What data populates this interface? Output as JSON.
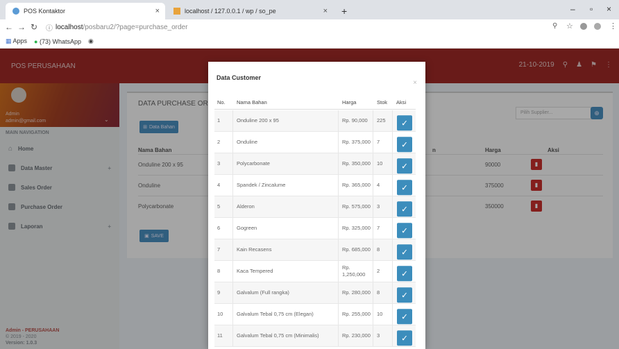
{
  "browser": {
    "tabs": [
      {
        "title": "POS Kontaktor",
        "active": true
      },
      {
        "title": "localhost / 127.0.0.1 / wp / so_pe",
        "active": false
      }
    ],
    "url_host": "localhost",
    "url_path": "/posbaru2/?page=purchase_order",
    "bookmarks": [
      "Apps",
      "(73) WhatsApp"
    ]
  },
  "app": {
    "brand": "POS PERUSAHAAN",
    "date": "21-10-2019",
    "user": {
      "name": "Admin",
      "email": "admin@gmail.com"
    },
    "main_navigation": "MAIN NAVIGATION",
    "menu": [
      {
        "label": "Home",
        "icon": "home-icon",
        "expandable": false
      },
      {
        "label": "Data Master",
        "icon": "folder-icon",
        "expandable": true
      },
      {
        "label": "Sales Order",
        "icon": "folder-icon",
        "expandable": false
      },
      {
        "label": "Purchase Order",
        "icon": "folder-icon",
        "expandable": false
      },
      {
        "label": "Laporan",
        "icon": "folder-icon",
        "expandable": true
      }
    ],
    "footer": {
      "line1": "Admin - PERUSAHAAN",
      "line2": "© 2019 - 2020",
      "line3": "Version: 1.0.3"
    },
    "content": {
      "title": "DATA PURCHASE ORDE",
      "add_button": "Data Bahan",
      "supplier_placeholder": "Pilih Supplier...",
      "save_button": "SAVE",
      "columns": {
        "nama": "Nama Bahan",
        "satuan": "n",
        "harga": "Harga",
        "aksi": "Aksi"
      },
      "rows": [
        {
          "nama": "Onduline 200 x 95",
          "harga": "90000"
        },
        {
          "nama": "Onduline",
          "harga": "375000"
        },
        {
          "nama": "Polycarbonate",
          "harga": "350000"
        }
      ]
    }
  },
  "modal": {
    "title": "Data Customer",
    "close": "×",
    "columns": {
      "no": "No.",
      "nama": "Nama Bahan",
      "harga": "Harga",
      "stok": "Stok",
      "aksi": "Aksi"
    },
    "rows": [
      {
        "no": "1",
        "nama": "Onduline 200 x 95",
        "harga": "Rp. 90,000",
        "stok": "225"
      },
      {
        "no": "2",
        "nama": "Onduline",
        "harga": "Rp. 375,000",
        "stok": "7"
      },
      {
        "no": "3",
        "nama": "Polycarbonate",
        "harga": "Rp. 350,000",
        "stok": "10"
      },
      {
        "no": "4",
        "nama": "Spandek / Zincalume",
        "harga": "Rp. 365,000",
        "stok": "4"
      },
      {
        "no": "5",
        "nama": "Alderon",
        "harga": "Rp. 575,000",
        "stok": "3"
      },
      {
        "no": "6",
        "nama": "Gogreen",
        "harga": "Rp. 325,000",
        "stok": "7"
      },
      {
        "no": "7",
        "nama": "Kain Recasens",
        "harga": "Rp. 685,000",
        "stok": "8"
      },
      {
        "no": "8",
        "nama": "Kaca Tempered",
        "harga": "Rp. 1,250,000",
        "stok": "2"
      },
      {
        "no": "9",
        "nama": "Galvalum (Full rangka)",
        "harga": "Rp. 280,000",
        "stok": "8"
      },
      {
        "no": "10",
        "nama": "Galvalum Tebal 0,75 cm (Elegan)",
        "harga": "Rp. 255,000",
        "stok": "10"
      },
      {
        "no": "11",
        "nama": "Galvalum Tebal 0,75 cm (Minimalis)",
        "harga": "Rp. 230,000",
        "stok": "3"
      }
    ],
    "pick_icon": "check-icon"
  },
  "colors": {
    "topbar": "#a02a26",
    "accent": "#3c8dbc",
    "danger": "#c9302c"
  }
}
